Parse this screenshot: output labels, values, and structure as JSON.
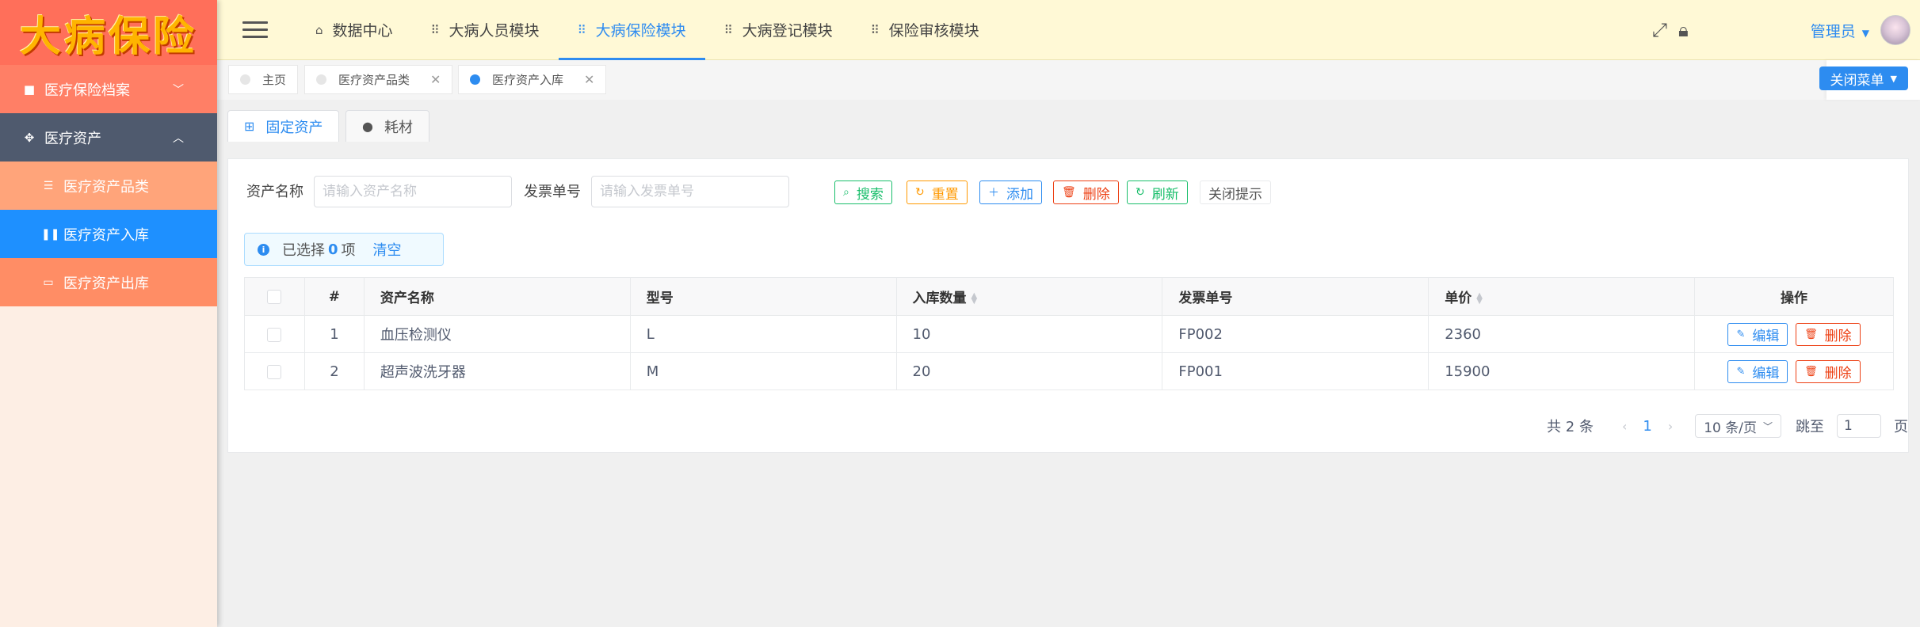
{
  "logo": {
    "text": "大病保险"
  },
  "sidebar": {
    "archive": {
      "icon": "folder-icon",
      "label": "医疗保险档案"
    },
    "assets": {
      "icon": "move-icon",
      "label": "医疗资产"
    },
    "subs": [
      {
        "icon": "sliders-icon",
        "label": "医疗资产品类"
      },
      {
        "icon": "pause-icon",
        "label": "医疗资产入库"
      },
      {
        "icon": "card-icon",
        "label": "医疗资产出库"
      }
    ],
    "colors": {
      "archive": "#ff7f66",
      "assets": "#4f5a6e",
      "active": "#1e90ff"
    }
  },
  "header": {
    "nav": [
      {
        "icon": "home-icon",
        "label": "数据中心"
      },
      {
        "icon": "grid-icon",
        "label": "大病人员模块"
      },
      {
        "icon": "grid-icon",
        "label": "大病保险模块"
      },
      {
        "icon": "grid-icon",
        "label": "大病登记模块"
      },
      {
        "icon": "grid-icon",
        "label": "保险审核模块"
      }
    ],
    "user": "管理员"
  },
  "tabs": [
    {
      "label": "主页"
    },
    {
      "label": "医疗资产品类"
    },
    {
      "label": "医疗资产入库"
    }
  ],
  "close_menu": "关闭菜单",
  "sub_tabs": [
    {
      "icon": "windows-icon",
      "label": "固定资产"
    },
    {
      "icon": "apple-icon",
      "label": "耗材"
    }
  ],
  "filters": {
    "asset_name_label": "资产名称",
    "asset_name_placeholder": "请输入资产名称",
    "invoice_label": "发票单号",
    "invoice_placeholder": "请输入发票单号"
  },
  "toolbar": {
    "search": "搜索",
    "reset": "重置",
    "add": "添加",
    "delete": "删除",
    "refresh": "刷新",
    "close_tip": "关闭提示"
  },
  "selection": {
    "prefix": "已选择",
    "count": "0",
    "suffix": "项",
    "clear": "清空"
  },
  "table": {
    "headers": [
      "#",
      "资产名称",
      "型号",
      "入库数量",
      "发票单号",
      "单价",
      "操作"
    ],
    "rows": [
      {
        "index": "1",
        "name": "血压检测仪",
        "model": "L",
        "quantity": "10",
        "invoice": "FP002",
        "price": "2360"
      },
      {
        "index": "2",
        "name": "超声波洗牙器",
        "model": "M",
        "quantity": "20",
        "invoice": "FP001",
        "price": "15900"
      }
    ],
    "edit": "编辑",
    "remove": "删除"
  },
  "pagination": {
    "total": "共 2 条",
    "current": "1",
    "page_size": "10 条/页",
    "jump_label": "跳至",
    "jump_value": "1",
    "page_unit": "页"
  }
}
